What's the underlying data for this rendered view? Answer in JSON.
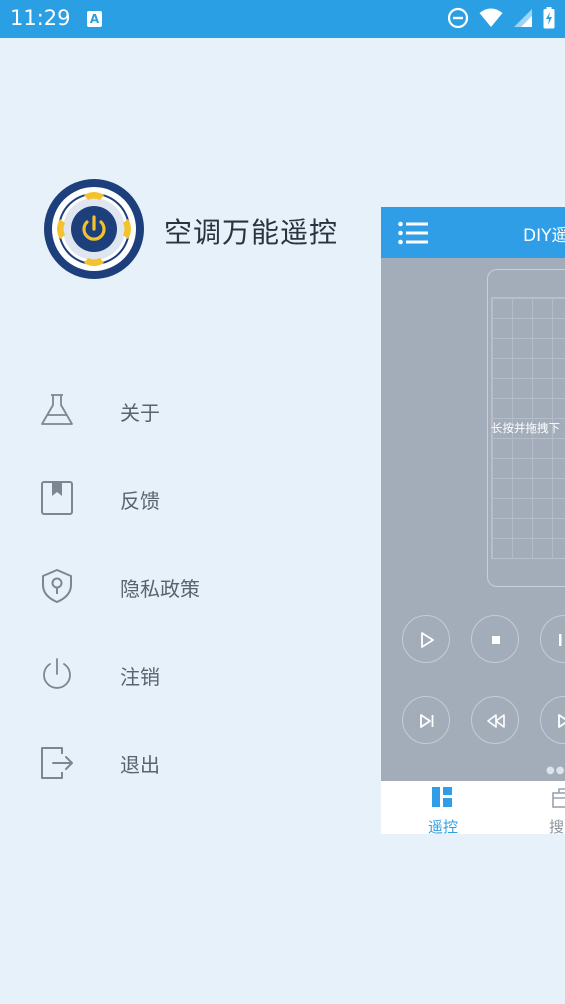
{
  "status_bar": {
    "time": "11:29",
    "notification_icon": "A",
    "icons": [
      "do-not-disturb-icon",
      "wifi-icon",
      "signal-icon",
      "battery-charging-icon"
    ]
  },
  "drawer": {
    "app_name": "空调万能遥控",
    "menu": [
      {
        "icon": "flask-icon",
        "label": "关于"
      },
      {
        "icon": "bookmark-icon",
        "label": "反馈"
      },
      {
        "icon": "shield-lock-icon",
        "label": "隐私政策"
      },
      {
        "icon": "power-icon",
        "label": "注销"
      },
      {
        "icon": "logout-icon",
        "label": "退出"
      }
    ]
  },
  "preview": {
    "title": "DIY遥",
    "hint": "长按并拖拽下",
    "tabs": [
      {
        "label": "遥控",
        "icon": "dashboard-icon",
        "active": true
      },
      {
        "label": "搜",
        "icon": "search-box-icon",
        "active": false
      }
    ],
    "controls": [
      "play-icon",
      "stop-icon",
      "pause-icon",
      "skip-next-icon",
      "rewind-icon",
      "forward-icon"
    ]
  },
  "colors": {
    "accent": "#2b9fe3",
    "background": "#e6f1fa",
    "logo_navy": "#1d3f7c",
    "logo_yellow": "#f5c22b"
  }
}
